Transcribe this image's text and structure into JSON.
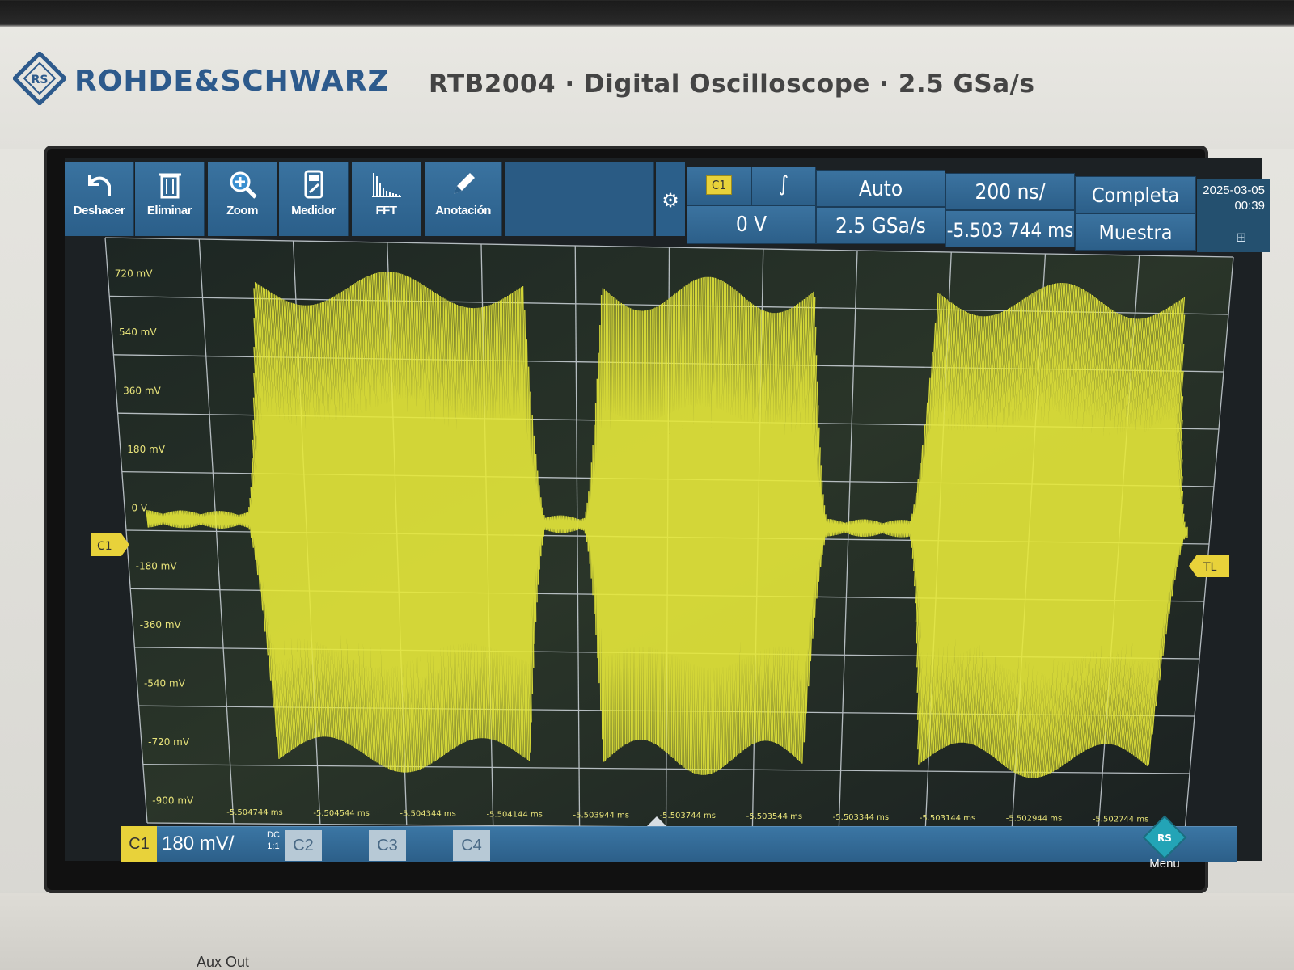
{
  "header": {
    "brand": "ROHDE&SCHWARZ",
    "model_line": "RTB2004 · Digital Oscilloscope · 2.5 GSa/s"
  },
  "toolbar": {
    "items": [
      {
        "label": "Deshacer",
        "icon": "undo-icon"
      },
      {
        "label": "Eliminar",
        "icon": "trash-icon"
      },
      {
        "label": "Zoom",
        "icon": "zoom-icon"
      },
      {
        "label": "Medidor",
        "icon": "meter-icon"
      },
      {
        "label": "FFT",
        "icon": "fft-icon"
      },
      {
        "label": "Anotación",
        "icon": "pencil-icon"
      }
    ]
  },
  "trigger": {
    "source": "C1",
    "level": "0 V",
    "mode": "Auto",
    "sample_rate": "2.5 GSa/s",
    "timebase": "200 ns/",
    "position": "-5.503 744 ms",
    "acquisition": "Completa",
    "acq_type": "Muestra"
  },
  "datetime": {
    "date": "2025-03-05",
    "time": "00:39"
  },
  "axis": {
    "y_labels": [
      "720 mV",
      "540 mV",
      "360 mV",
      "180 mV",
      "0 V",
      "-180 mV",
      "-360 mV",
      "-540 mV",
      "-720 mV",
      "-900 mV"
    ],
    "x_labels": [
      "-5.504744 ms",
      "-5.504544 ms",
      "-5.504344 ms",
      "-5.504144 ms",
      "-5.503944 ms",
      "-5.503744 ms",
      "-5.503544 ms",
      "-5.503344 ms",
      "-5.503144 ms",
      "-5.502944 ms",
      "-5.502744 ms"
    ],
    "ch_marker": "C1",
    "trig_marker": "TL",
    "trace_color": "#e6e83a"
  },
  "channel_bar": {
    "ch1_label": "C1",
    "ch1_scale": "180 mV/",
    "coupling": "DC",
    "probe": "1:1",
    "ch2": "C2",
    "ch3": "C3",
    "ch4": "C4",
    "menu": "Menu"
  },
  "panel": {
    "aux_out": "Aux Out"
  }
}
